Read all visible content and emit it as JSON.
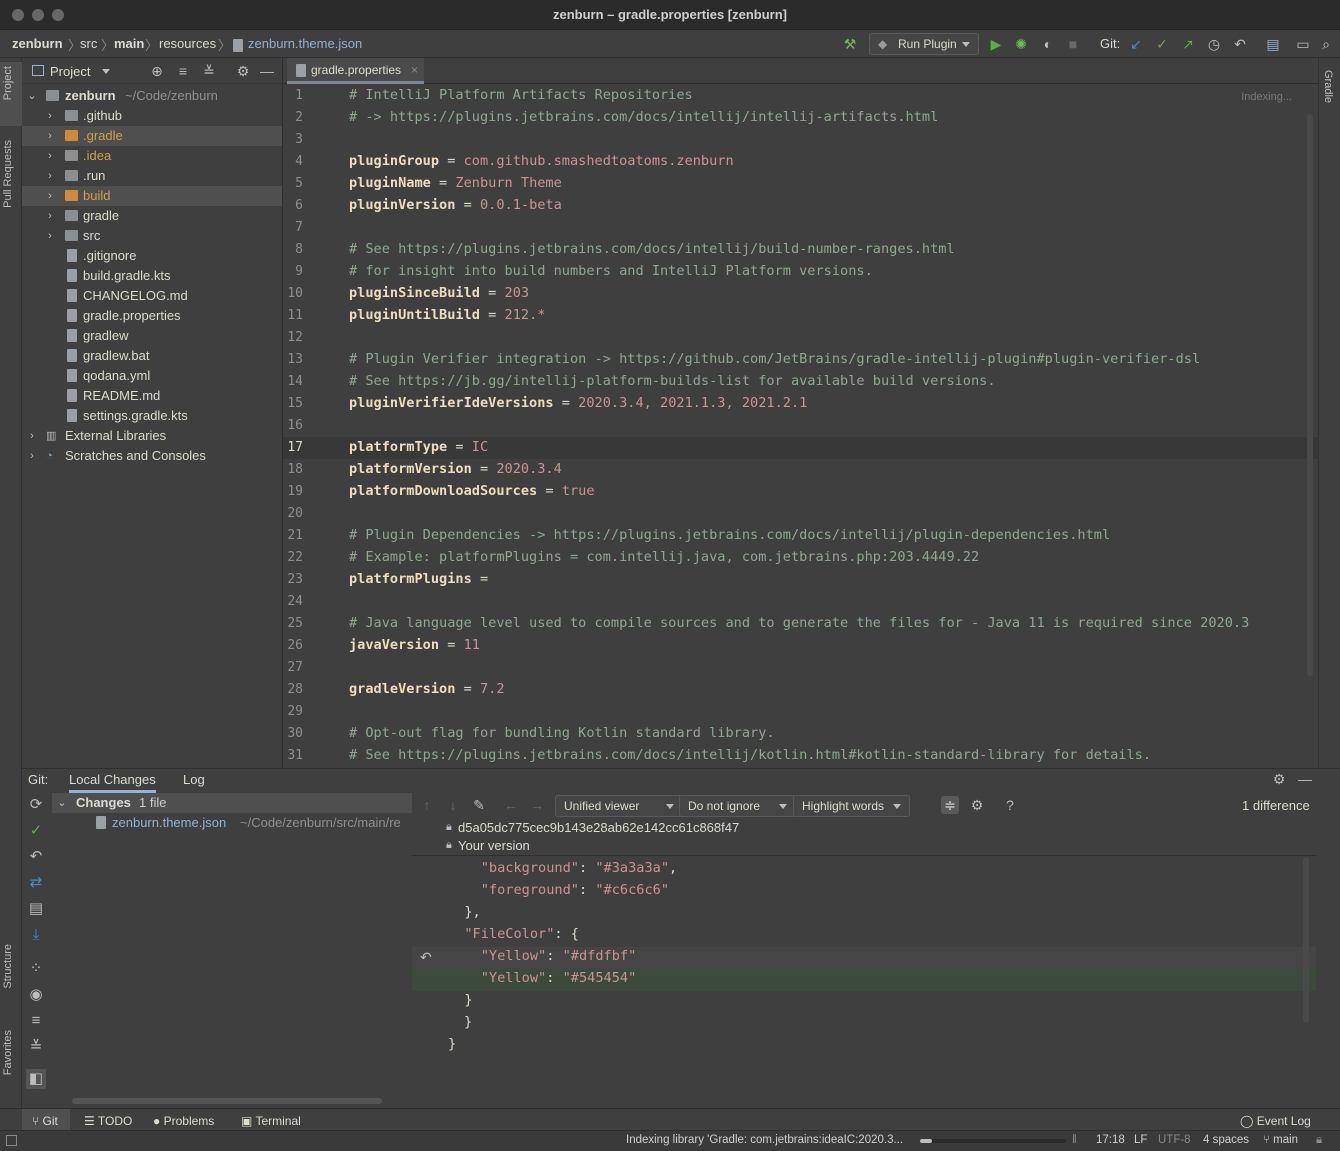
{
  "window": {
    "title": "zenburn – gradle.properties [zenburn]"
  },
  "breadcrumb": [
    "zenburn",
    "src",
    "main",
    "resources",
    "zenburn.theme.json"
  ],
  "toolbar": {
    "run_config": "Run Plugin",
    "git_label": "Git:",
    "run_color": "#54b33e",
    "git_update_color": "#3d8fd1"
  },
  "left_strip": {
    "project": "Project",
    "pull_requests": "Pull Requests",
    "structure": "Structure",
    "favorites": "Favorites"
  },
  "right_strip": {
    "gradle": "Gradle"
  },
  "project_panel": {
    "title": "Project",
    "root_name": "zenburn",
    "root_path": "~/Code/zenburn",
    "items": [
      {
        "label": ".github",
        "kind": "folder",
        "color": "#dcdccc"
      },
      {
        "label": ".gradle",
        "kind": "folder-orange",
        "color": "#d0a040"
      },
      {
        "label": ".idea",
        "kind": "folder",
        "color": "#d0a040"
      },
      {
        "label": ".run",
        "kind": "folder",
        "color": "#dcdccc"
      },
      {
        "label": "build",
        "kind": "folder-orange",
        "color": "#d0a040"
      },
      {
        "label": "gradle",
        "kind": "folder",
        "color": "#dcdccc"
      },
      {
        "label": "src",
        "kind": "folder",
        "color": "#dcdccc"
      },
      {
        "label": ".gitignore",
        "kind": "file",
        "color": "#dcdccc"
      },
      {
        "label": "build.gradle.kts",
        "kind": "file",
        "color": "#dcdccc"
      },
      {
        "label": "CHANGELOG.md",
        "kind": "file",
        "color": "#dcdccc"
      },
      {
        "label": "gradle.properties",
        "kind": "file",
        "color": "#dcdccc"
      },
      {
        "label": "gradlew",
        "kind": "file",
        "color": "#dcdccc"
      },
      {
        "label": "gradlew.bat",
        "kind": "file",
        "color": "#dcdccc"
      },
      {
        "label": "qodana.yml",
        "kind": "file",
        "color": "#dcdccc"
      },
      {
        "label": "README.md",
        "kind": "file",
        "color": "#dcdccc"
      },
      {
        "label": "settings.gradle.kts",
        "kind": "file",
        "color": "#dcdccc"
      }
    ],
    "external_libraries": "External Libraries",
    "scratches": "Scratches and Consoles"
  },
  "editor": {
    "tab": "gradle.properties",
    "status": "Indexing...",
    "lines": [
      {
        "t": "c",
        "text": "# IntelliJ Platform Artifacts Repositories"
      },
      {
        "t": "c",
        "text": "# -> https://plugins.jetbrains.com/docs/intellij/intellij-artifacts.html"
      },
      {
        "t": "e"
      },
      {
        "t": "p",
        "key": "pluginGroup",
        "val": "com.github.smashedtoatoms.zenburn"
      },
      {
        "t": "p",
        "key": "pluginName",
        "val": "Zenburn Theme"
      },
      {
        "t": "p",
        "key": "pluginVersion",
        "val": "0.0.1-beta"
      },
      {
        "t": "e"
      },
      {
        "t": "c",
        "text": "# See https://plugins.jetbrains.com/docs/intellij/build-number-ranges.html"
      },
      {
        "t": "c",
        "text": "# for insight into build numbers and IntelliJ Platform versions."
      },
      {
        "t": "p",
        "key": "pluginSinceBuild",
        "val": "203"
      },
      {
        "t": "p",
        "key": "pluginUntilBuild",
        "val": "212.*"
      },
      {
        "t": "e"
      },
      {
        "t": "c",
        "text": "# Plugin Verifier integration -> https://github.com/JetBrains/gradle-intellij-plugin#plugin-verifier-dsl"
      },
      {
        "t": "c",
        "text": "# See https://jb.gg/intellij-platform-builds-list for available build versions."
      },
      {
        "t": "p",
        "key": "pluginVerifierIdeVersions",
        "val": "2020.3.4, 2021.1.3, 2021.2.1"
      },
      {
        "t": "e"
      },
      {
        "t": "p",
        "key": "platformType",
        "val": "IC"
      },
      {
        "t": "p",
        "key": "platformVersion",
        "val": "2020.3.4"
      },
      {
        "t": "p",
        "key": "platformDownloadSources",
        "val": "true"
      },
      {
        "t": "e"
      },
      {
        "t": "c",
        "text": "# Plugin Dependencies -> https://plugins.jetbrains.com/docs/intellij/plugin-dependencies.html"
      },
      {
        "t": "c",
        "text": "# Example: platformPlugins = com.intellij.java, com.jetbrains.php:203.4449.22"
      },
      {
        "t": "p",
        "key": "platformPlugins",
        "val": ""
      },
      {
        "t": "e"
      },
      {
        "t": "c",
        "text": "# Java language level used to compile sources and to generate the files for - Java 11 is required since 2020.3"
      },
      {
        "t": "p",
        "key": "javaVersion",
        "val": "11"
      },
      {
        "t": "e"
      },
      {
        "t": "p",
        "key": "gradleVersion",
        "val": "7.2"
      },
      {
        "t": "e"
      },
      {
        "t": "c",
        "text": "# Opt-out flag for bundling Kotlin standard library."
      },
      {
        "t": "c",
        "text": "# See https://plugins.jetbrains.com/docs/intellij/kotlin.html#kotlin-standard-library for details."
      }
    ]
  },
  "git_panel": {
    "label": "Git:",
    "tabs": [
      "Local Changes",
      "Log"
    ],
    "changes_label": "Changes",
    "changes_count": "1 file",
    "changed_file": "zenburn.theme.json",
    "changed_path": "~/Code/zenburn/src/main/re",
    "viewer": "Unified viewer",
    "ignore": "Do not ignore",
    "highlight": "Highlight words",
    "help": "?",
    "difference_count": "1 difference",
    "hash": "d5a05dc775cec9b143e28ab62e142cc61c868f47",
    "your_version": "Your version",
    "diff_lines": [
      {
        "text": "    \"background\": \"#3a3a3a\",",
        "state": "normal"
      },
      {
        "text": "    \"foreground\": \"#c6c6c6\"",
        "state": "normal"
      },
      {
        "text": "  },",
        "state": "normal"
      },
      {
        "text": "  \"FileColor\": {",
        "state": "normal"
      },
      {
        "text": "    \"Yellow\": \"#dfdfbf\"",
        "state": "removed"
      },
      {
        "text": "    \"Yellow\": \"#545454\"",
        "state": "added"
      },
      {
        "text": "  }",
        "state": "normal"
      },
      {
        "text": "}",
        "state": "normal"
      },
      {
        "text": "}",
        "state": "normal"
      }
    ]
  },
  "bottom_tabs": [
    "Git",
    "TODO",
    "Problems",
    "Terminal"
  ],
  "event_log": "Event Log",
  "statusbar": {
    "indexing": "Indexing library 'Gradle: com.jetbrains:ideaIC:2020.3...",
    "position": "17:18",
    "line_sep": "LF",
    "encoding": "UTF-8",
    "indent": "4 spaces",
    "branch": "main"
  }
}
